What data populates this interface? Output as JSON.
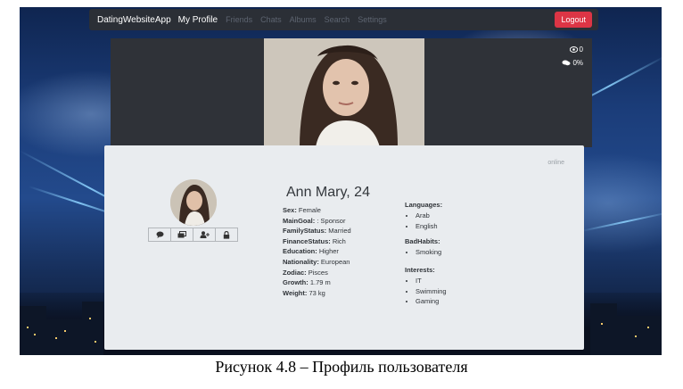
{
  "navbar": {
    "brand": "DatingWebsiteApp",
    "links": [
      "My Profile",
      "Friends",
      "Chats",
      "Albums",
      "Search",
      "Settings"
    ],
    "logout_label": "Logout"
  },
  "cover": {
    "views": "0",
    "comments": "0%"
  },
  "profile": {
    "status": "online",
    "name_line": "Ann Mary, 24",
    "attributes": [
      {
        "label": "Sex:",
        "value": " Female"
      },
      {
        "label": "MainGoal:",
        "value": " : Sponsor"
      },
      {
        "label": "FamilyStatus:",
        "value": " Married"
      },
      {
        "label": "FinanceStatus:",
        "value": " Rich"
      },
      {
        "label": "Education:",
        "value": " Higher"
      },
      {
        "label": "Nationality:",
        "value": " European"
      },
      {
        "label": "Zodiac:",
        "value": " Pisces"
      },
      {
        "label": "Growth:",
        "value": " 1.79 m"
      },
      {
        "label": "Weight:",
        "value": " 73 kg"
      }
    ],
    "languages_title": "Languages:",
    "languages": [
      "Arab",
      "English"
    ],
    "badhabits_title": "BadHabits:",
    "badhabits": [
      "Smoking"
    ],
    "interests_title": "Interests:",
    "interests": [
      "IT",
      "Swimming",
      "Gaming"
    ],
    "action_icons": [
      "chat-icon",
      "album-icon",
      "add-friend-icon",
      "lock-icon"
    ]
  },
  "caption": "Рисунок 4.8 – Профиль пользователя"
}
